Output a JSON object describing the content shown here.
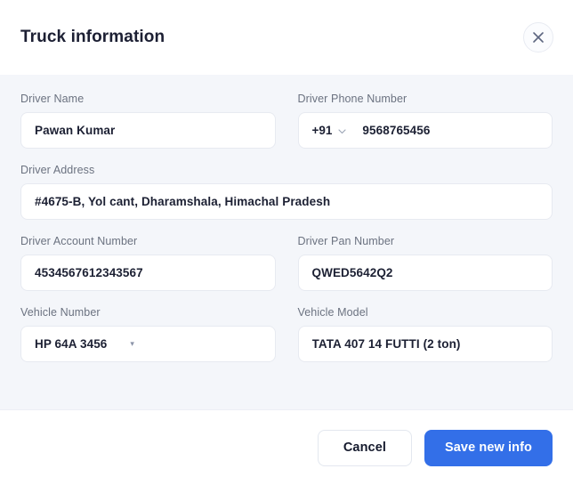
{
  "dialog": {
    "title": "Truck information",
    "close_icon": "close-icon"
  },
  "form": {
    "rows": [
      {
        "fields": [
          {
            "key": "driver_name",
            "label": "Driver Name",
            "value": "Pawan Kumar",
            "type": "text"
          },
          {
            "key": "driver_phone",
            "label": "Driver Phone Number",
            "country_code": "+91",
            "value": "9568765456",
            "type": "phone",
            "caret_icon": "chevron-down-icon"
          }
        ]
      },
      {
        "fields": [
          {
            "key": "driver_address",
            "label": "Driver Address",
            "value": "#4675-B, Yol cant, Dharamshala, Himachal Pradesh",
            "type": "text"
          }
        ]
      },
      {
        "fields": [
          {
            "key": "driver_account_number",
            "label": "Driver Account Number",
            "value": "4534567612343567",
            "type": "text"
          },
          {
            "key": "driver_pan_number",
            "label": "Driver Pan Number",
            "value": "QWED5642Q2",
            "type": "text"
          }
        ]
      },
      {
        "fields": [
          {
            "key": "vehicle_number",
            "label": "Vehicle Number",
            "value": "HP 64A 3456",
            "type": "select",
            "caret_icon": "caret-down-icon",
            "caret_glyph": "▾"
          },
          {
            "key": "vehicle_model",
            "label": "Vehicle Model",
            "value": "TATA 407 14 FUTTI (2 ton)",
            "type": "text"
          }
        ]
      }
    ]
  },
  "footer": {
    "cancel_label": "Cancel",
    "save_label": "Save new info"
  },
  "colors": {
    "primary": "#336fe8",
    "body_background": "#f4f6fa",
    "surface": "#ffffff",
    "text_primary": "#1c2033",
    "text_label": "#6b7280",
    "border": "#e7eaf1"
  }
}
